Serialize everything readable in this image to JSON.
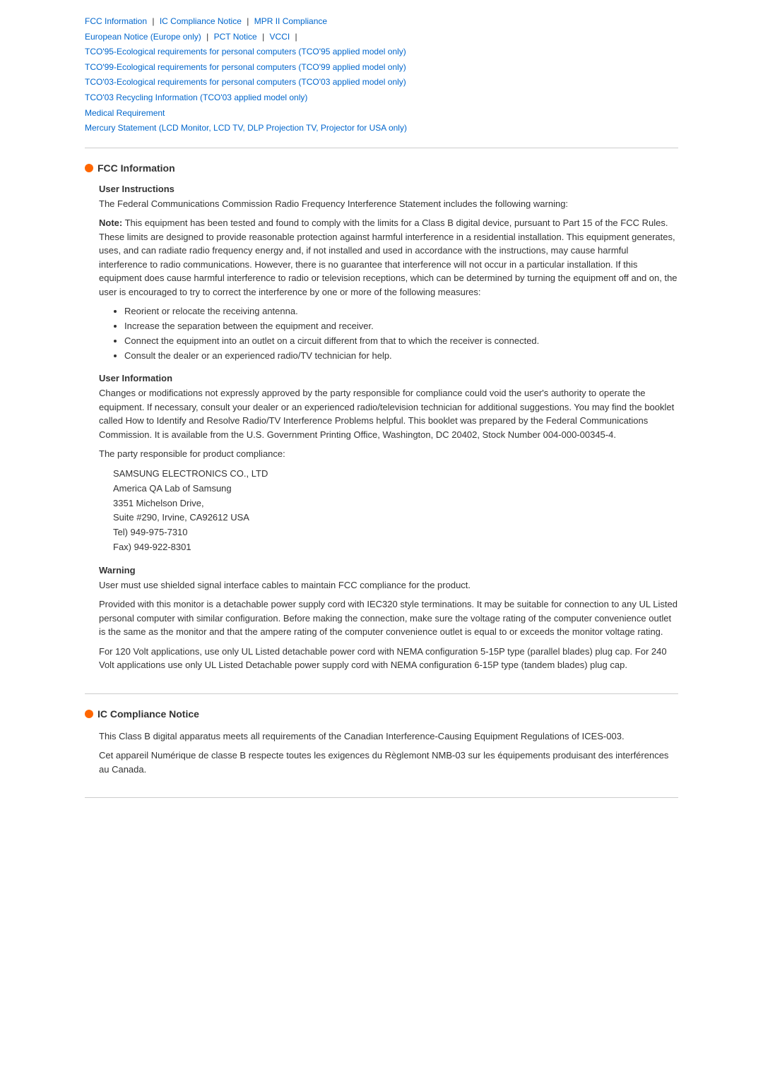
{
  "nav": {
    "links": [
      {
        "label": "FCC Information",
        "id": "fcc"
      },
      {
        "label": "IC Compliance Notice",
        "id": "ic"
      },
      {
        "label": "MPR II Compliance",
        "id": "mpr"
      },
      {
        "label": "European Notice (Europe only)",
        "id": "eu"
      },
      {
        "label": "PCT Notice",
        "id": "pct"
      },
      {
        "label": "VCCI",
        "id": "vcci"
      },
      {
        "label": "TCO'95-Ecological requirements for personal computers (TCO'95 applied model only)",
        "id": "tco95"
      },
      {
        "label": "TCO'99-Ecological requirements for personal computers (TCO'99 applied model only)",
        "id": "tco99"
      },
      {
        "label": "TCO'03-Ecological requirements for personal computers (TCO'03 applied model only)",
        "id": "tco03"
      },
      {
        "label": "TCO'03 Recycling Information (TCO'03 applied model only)",
        "id": "tco03r"
      },
      {
        "label": "Medical Requirement",
        "id": "medical"
      },
      {
        "label": "Mercury Statement (LCD Monitor, LCD TV, DLP Projection TV, Projector for USA only)",
        "id": "mercury"
      }
    ]
  },
  "fcc_section": {
    "title": "FCC Information",
    "user_instructions": {
      "subtitle": "User Instructions",
      "intro": "The Federal Communications Commission Radio Frequency Interference Statement includes the following warning:",
      "note_bold": "Note:",
      "note_text": " This equipment has been tested and found to comply with the limits for a Class B digital device, pursuant to Part 15 of the FCC Rules. These limits are designed to provide reasonable protection against harmful interference in a residential installation. This equipment generates, uses, and can radiate radio frequency energy and, if not installed and used in accordance with the instructions, may cause harmful interference to radio communications. However, there is no guarantee that interference will not occur in a particular installation. If this equipment does cause harmful interference to radio or television receptions, which can be determined by turning the equipment off and on, the user is encouraged to try to correct the interference by one or more of the following measures:",
      "measures": [
        "Reorient or relocate the receiving antenna.",
        "Increase the separation between the equipment and receiver.",
        "Connect the equipment into an outlet on a circuit different from that to which the receiver is connected.",
        "Consult the dealer or an experienced radio/TV technician for help."
      ]
    },
    "user_information": {
      "subtitle": "User Information",
      "paragraph1": "Changes or modifications not expressly approved by the party responsible for compliance could void the user's authority to operate the equipment. If necessary, consult your dealer or an experienced radio/television technician for additional suggestions. You may find the booklet called How to Identify and Resolve Radio/TV Interference Problems helpful. This booklet was prepared by the Federal Communications Commission. It is available from the U.S. Government Printing Office, Washington, DC 20402, Stock Number 004-000-00345-4.",
      "paragraph2": "The party responsible for product compliance:",
      "address_lines": [
        "SAMSUNG ELECTRONICS CO., LTD",
        "America QA Lab of Samsung",
        "3351 Michelson Drive,",
        "Suite #290, Irvine, CA92612 USA",
        "Tel) 949-975-7310",
        "Fax) 949-922-8301"
      ]
    },
    "warning": {
      "subtitle": "Warning",
      "paragraph1": "User must use shielded signal interface cables to maintain FCC compliance for the product.",
      "paragraph2": "Provided with this monitor is a detachable power supply cord with IEC320 style terminations. It may be suitable for connection to any UL Listed personal computer with similar configuration. Before making the connection, make sure the voltage rating of the computer convenience outlet is the same as the monitor and that the ampere rating of the computer convenience outlet is equal to or exceeds the monitor voltage rating.",
      "paragraph3": "For 120 Volt applications, use only UL Listed detachable power cord with NEMA configuration 5-15P type (parallel blades) plug cap. For 240 Volt applications use only UL Listed Detachable power supply cord with NEMA configuration 6-15P type (tandem blades) plug cap."
    }
  },
  "ic_section": {
    "title": "IC Compliance Notice",
    "paragraph1": "This Class B digital apparatus meets all requirements of the Canadian Interference-Causing Equipment Regulations of ICES-003.",
    "paragraph2": "Cet appareil Numérique de classe B respecte toutes les exigences du Règlemont NMB-03 sur les équipements produisant des interférences au Canada."
  }
}
